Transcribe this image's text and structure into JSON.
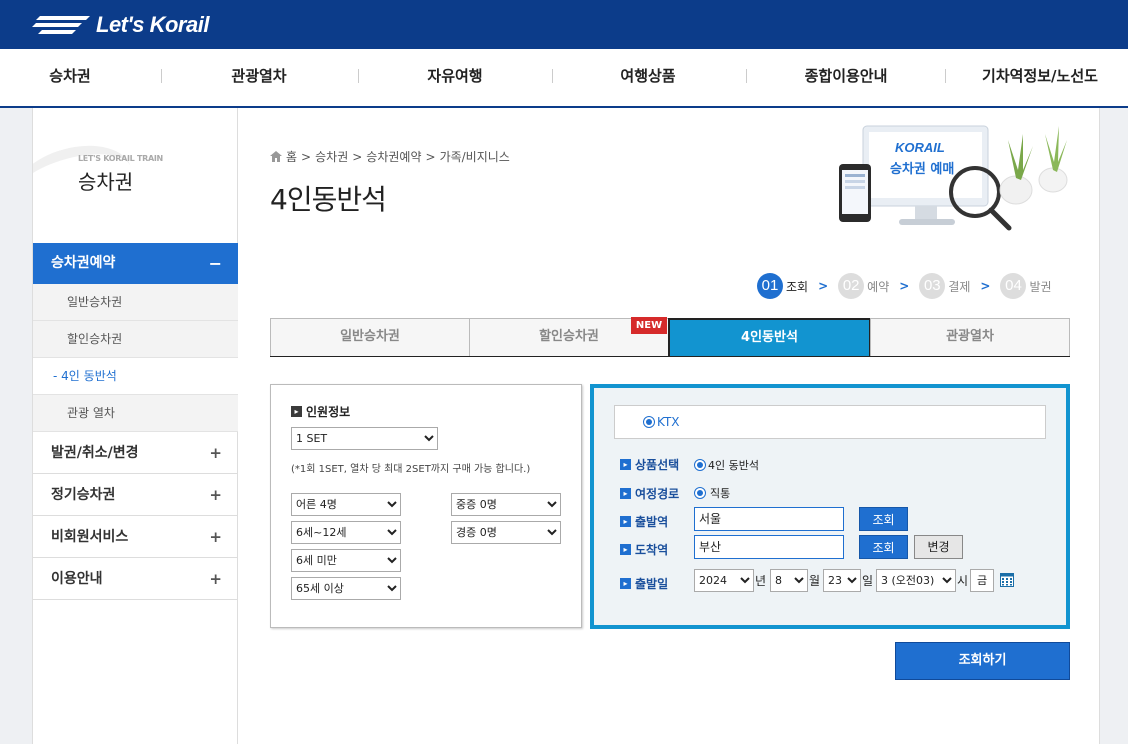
{
  "brand": {
    "logo_text": "Let's Korail"
  },
  "gnb": {
    "items": [
      {
        "label": "승차권"
      },
      {
        "label": "관광열차"
      },
      {
        "label": "자유여행"
      },
      {
        "label": "여행상품"
      },
      {
        "label": "종합이용안내"
      },
      {
        "label": "기차역정보/노선도"
      }
    ]
  },
  "sidebar": {
    "subtitle": "LET'S KORAIL TRAIN",
    "title": "승차권",
    "active_group": {
      "label": "승차권예약",
      "toggle": "−"
    },
    "sub_items": [
      {
        "label": "일반승차권"
      },
      {
        "label": "할인승차권"
      },
      {
        "label": "4인 동반석",
        "bullet": "-"
      },
      {
        "label": "관광 열차"
      }
    ],
    "groups": [
      {
        "label": "발권/취소/변경",
        "toggle": "+"
      },
      {
        "label": "정기승차권",
        "toggle": "+"
      },
      {
        "label": "비회원서비스",
        "toggle": "+"
      },
      {
        "label": "이용안내",
        "toggle": "+"
      }
    ]
  },
  "breadcrumb": {
    "home": "홈",
    "sep": ">",
    "items": [
      "승차권",
      "승차권예약",
      "가족/비지니스"
    ]
  },
  "page_title": "4인동반석",
  "illustration": {
    "logo": "KORAIL",
    "text": "승차권 예매"
  },
  "steps": [
    {
      "num": "01",
      "label": "조회",
      "active": true
    },
    {
      "num": "02",
      "label": "예약",
      "active": false
    },
    {
      "num": "03",
      "label": "결제",
      "active": false
    },
    {
      "num": "04",
      "label": "발권",
      "active": false
    }
  ],
  "tabs": [
    {
      "label": "일반승차권"
    },
    {
      "label": "할인승차권"
    },
    {
      "label": "4인동반석"
    },
    {
      "label": "관광열차"
    }
  ],
  "new_badge": "NEW",
  "passenger": {
    "section_label": "인원정보",
    "set_value": "1 SET",
    "note": "(*1회 1SET, 열차 당 최대 2SET까지 구매 가능 합니다.)",
    "adult": "어른 4명",
    "child": "6세~12세",
    "infant": "6세 미만",
    "senior": "65세 이상",
    "severe": "중증 0명",
    "mild": "경증 0명"
  },
  "search": {
    "train_type": "KTX",
    "product_label": "상품선택",
    "product_value": "4인 동반석",
    "route_label": "여정경로",
    "route_value": "직통",
    "dep_label": "출발역",
    "dep_value": "서울",
    "arr_label": "도착역",
    "arr_value": "부산",
    "lookup_btn": "조회",
    "change_btn": "변경",
    "date_label": "출발일",
    "year": "2024",
    "year_unit": "년",
    "month": "8",
    "month_unit": "월",
    "day": "23",
    "day_unit": "일",
    "hour": "3 (오전03)",
    "hour_unit": "시",
    "weekday": "금"
  },
  "submit_btn": "조회하기",
  "colors": {
    "primary": "#1f6fd0",
    "header": "#0c3c8a",
    "accent": "#1294d0",
    "badge": "#d62a2a"
  }
}
